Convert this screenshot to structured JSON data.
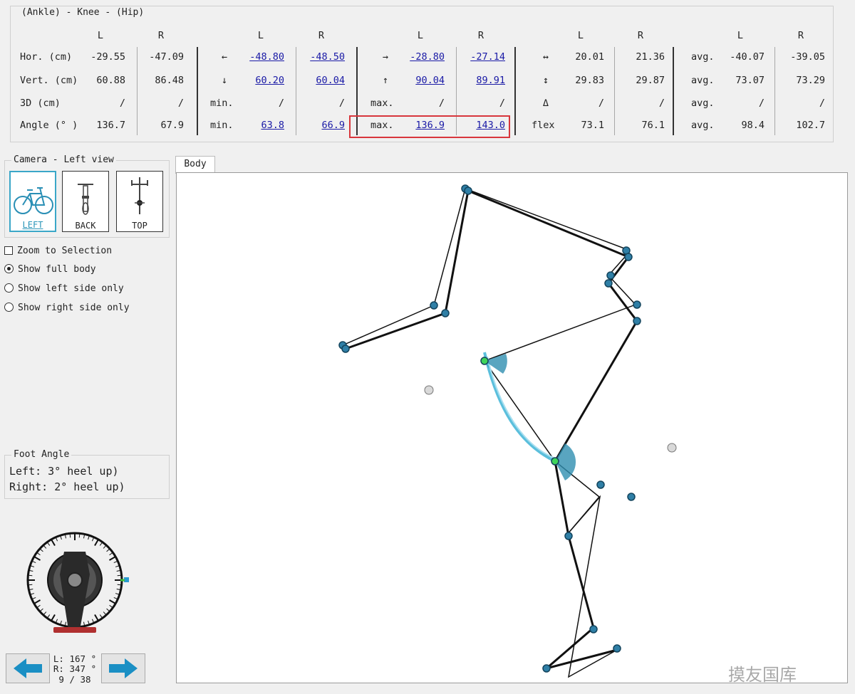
{
  "metrics": {
    "legend": "(Ankle) - Knee - (Hip)",
    "col_L": "L",
    "col_R": "R",
    "rows": [
      {
        "label": "Hor. (cm)",
        "val_L": "-29.55",
        "val_R": "-47.09",
        "g1_label": "←",
        "g1_L": "-48.80",
        "g1_R": "-48.50",
        "g2_label": "→",
        "g2_L": "-28.80",
        "g2_R": "-27.14",
        "g3_label": "↔",
        "g3_L": "20.01",
        "g3_R": "21.36",
        "g4_label": "avg.",
        "g4_L": "-40.07",
        "g4_R": "-39.05"
      },
      {
        "label": "Vert. (cm)",
        "val_L": "60.88",
        "val_R": "86.48",
        "g1_label": "↓",
        "g1_L": "60.20",
        "g1_R": "60.04",
        "g2_label": "↑",
        "g2_L": "90.04",
        "g2_R": "89.91",
        "g3_label": "↕",
        "g3_L": "29.83",
        "g3_R": "29.87",
        "g4_label": "avg.",
        "g4_L": "73.07",
        "g4_R": "73.29"
      },
      {
        "label": "3D (cm)",
        "val_L": "/",
        "val_R": "/",
        "g1_label": "min.",
        "g1_L": "/",
        "g1_R": "/",
        "g2_label": "max.",
        "g2_L": "/",
        "g2_R": "/",
        "g3_label": "Δ",
        "g3_L": "/",
        "g3_R": "/",
        "g4_label": "avg.",
        "g4_L": "/",
        "g4_R": "/"
      },
      {
        "label": "Angle (° )",
        "val_L": "136.7",
        "val_R": "67.9",
        "g1_label": "min.",
        "g1_L": "63.8",
        "g1_R": "66.9",
        "g2_label": "max.",
        "g2_L": "136.9",
        "g2_R": "143.0",
        "g3_label": "flex",
        "g3_L": "73.1",
        "g3_R": "76.1",
        "g4_label": "avg.",
        "g4_L": "98.4",
        "g4_R": "102.7"
      }
    ]
  },
  "camera": {
    "legend": "Camera - Left view",
    "left_label": "LEFT",
    "back_label": "BACK",
    "top_label": "TOP"
  },
  "options": {
    "zoom": "Zoom to Selection",
    "full_body": "Show full body",
    "left_only": "Show left side only",
    "right_only": "Show right side only"
  },
  "foot_angle": {
    "legend": "Foot Angle",
    "left": "Left:     3° heel up)",
    "right": "Right:    2° heel up)"
  },
  "crank": {
    "left_angle": "L: 167 °",
    "right_angle": "R: 347 °",
    "frame": "9 / 38"
  },
  "body_tab": "Body",
  "watermark": "摸友国库",
  "colors": {
    "joint": "#2f7fa6",
    "highlight": "#d8363c",
    "angle_arc": "#49b8d8",
    "active_camera": "#3aa7c8"
  }
}
